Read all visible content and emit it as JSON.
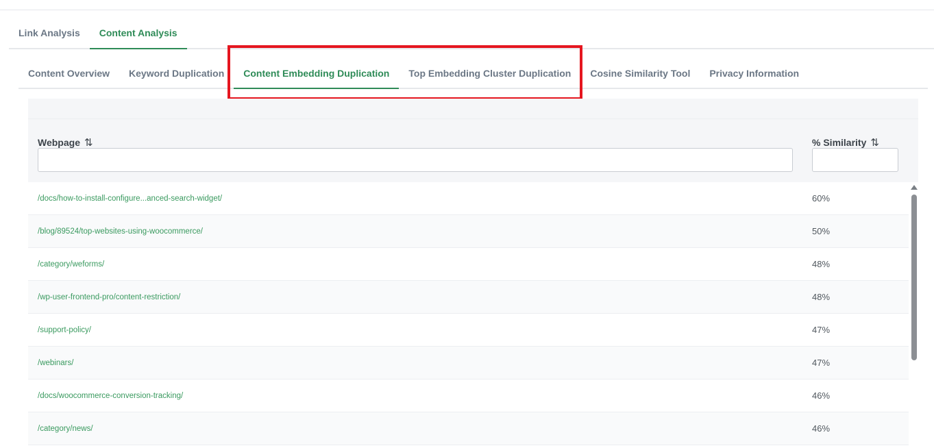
{
  "main_tabs": [
    {
      "label": "Link Analysis",
      "active": false
    },
    {
      "label": "Content Analysis",
      "active": true
    }
  ],
  "sub_tabs": [
    {
      "label": "Content Overview",
      "active": false
    },
    {
      "label": "Keyword Duplication",
      "active": false
    },
    {
      "label": "Content Embedding Duplication",
      "active": true
    },
    {
      "label": "Top Embedding Cluster Duplication",
      "active": false
    },
    {
      "label": "Cosine Similarity Tool",
      "active": false
    },
    {
      "label": "Privacy Information",
      "active": false
    }
  ],
  "table": {
    "columns": [
      {
        "label": "Webpage",
        "sort_icon": "⇅"
      },
      {
        "label": "% Similarity",
        "sort_icon": "⇅"
      }
    ],
    "webpage_filter": {
      "value": "",
      "placeholder": ""
    },
    "similarity_filter": {
      "value": "",
      "placeholder": ""
    },
    "rows": [
      {
        "url": "/docs/how-to-install-configure...anced-search-widget/",
        "similarity": "60%"
      },
      {
        "url": "/blog/89524/top-websites-using-woocommerce/",
        "similarity": "50%"
      },
      {
        "url": "/category/weforms/",
        "similarity": "48%"
      },
      {
        "url": "/wp-user-frontend-pro/content-restriction/",
        "similarity": "48%"
      },
      {
        "url": "/support-policy/",
        "similarity": "47%"
      },
      {
        "url": "/webinars/",
        "similarity": "47%"
      },
      {
        "url": "/docs/woocommerce-conversion-tracking/",
        "similarity": "46%"
      },
      {
        "url": "/category/news/",
        "similarity": "46%"
      }
    ]
  },
  "colors": {
    "accent": "#2e8b57",
    "highlight_box": "#e5161f",
    "link": "#3a9a5f"
  }
}
